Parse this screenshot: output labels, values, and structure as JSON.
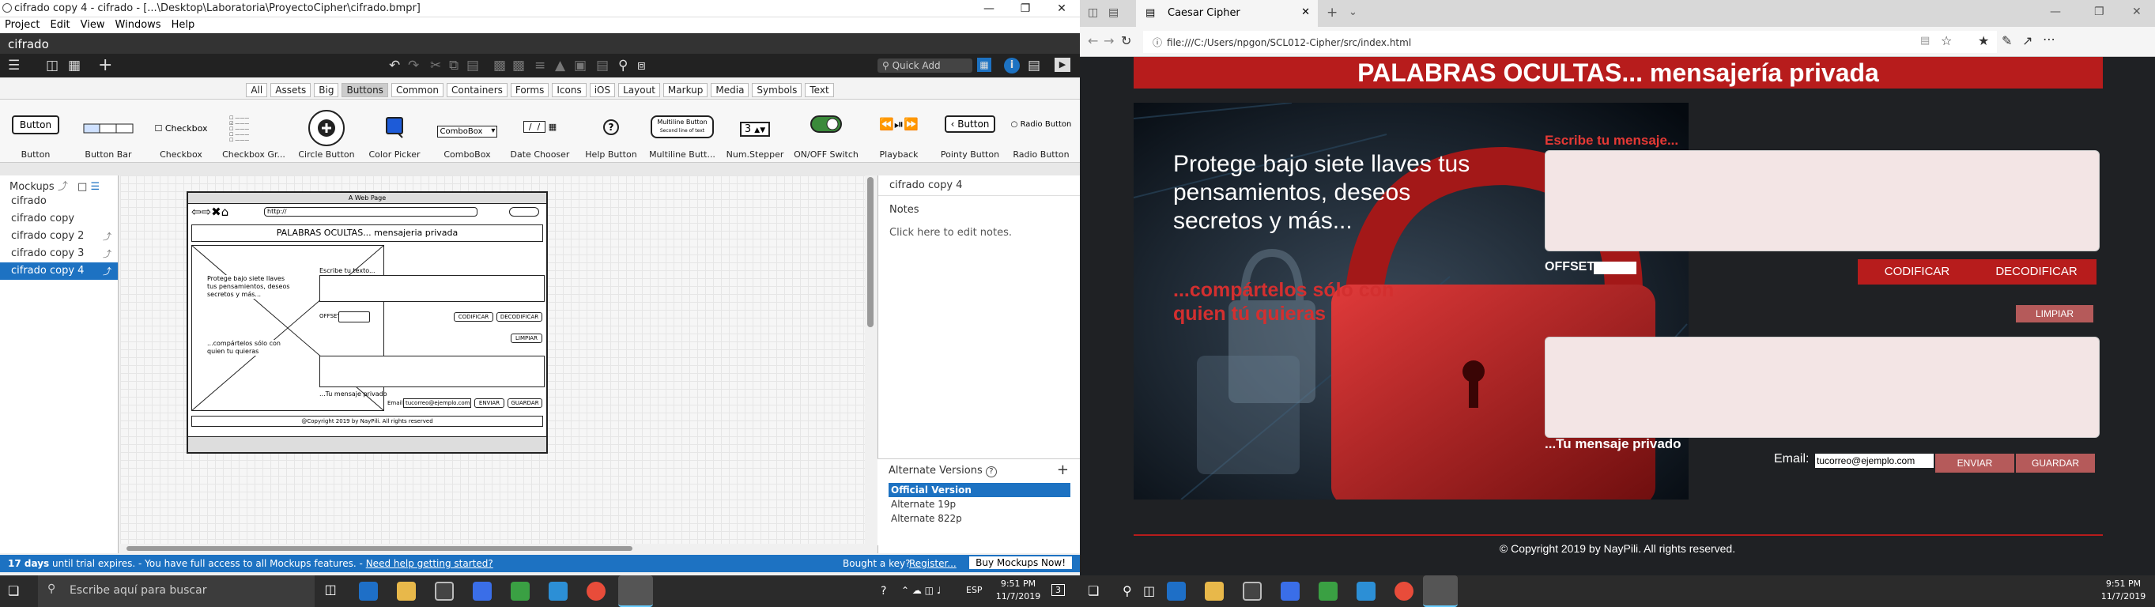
{
  "left": {
    "title": "cifrado copy 4 - cifrado - [...\\Desktop\\Laboratoria\\ProyectoCipher\\cifrado.bmpr]",
    "menu": [
      "Project",
      "Edit",
      "View",
      "Windows",
      "Help"
    ],
    "doc_name": "cifrado",
    "quick_add": "Quick Add",
    "categories": [
      "All",
      "Assets",
      "Big",
      "Buttons",
      "Common",
      "Containers",
      "Forms",
      "Icons",
      "iOS",
      "Layout",
      "Markup",
      "Media",
      "Symbols",
      "Text"
    ],
    "selected_category": "Buttons",
    "library": [
      "Button",
      "Button Bar",
      "Checkbox",
      "Checkbox Gr...",
      "Circle Button",
      "Color Picker",
      "ComboBox",
      "Date Chooser",
      "Help Button",
      "Multiline Butt...",
      "Num.Stepper",
      "ON/OFF Switch",
      "Playback",
      "Pointy Button",
      "Radio Button"
    ],
    "lib_previews": {
      "button": "Button",
      "checkbox": "Checkbox",
      "combobox": "ComboBox",
      "multiline": "Multiline Button",
      "multiline_sub": "Second line of text",
      "stepper": "3",
      "pointy": "Button",
      "radio": "Radio Button"
    },
    "sidebar_title": "Mockups",
    "mockups": [
      "cifrado",
      "cifrado copy",
      "cifrado copy 2",
      "cifrado copy 3",
      "cifrado copy 4"
    ],
    "selected_mockup": "cifrado copy 4",
    "mock": {
      "window_title": "A Web Page",
      "url": "http://",
      "heading": "PALABRAS OCULTAS... mensajeria privada",
      "hero_text": "Protege bajo siete llaves tus pensamientos, deseos secretos y más...",
      "hero_sub": "...compártelos sólo con quien tu quieras",
      "write_label": "Escribe tu texto...",
      "offset": "OFFSET",
      "encode": "CODIFICAR",
      "decode": "DECODIFICAR",
      "clear": "LIMPIAR",
      "private_msg": "...Tu mensaje privado",
      "email_label": "Email",
      "email_value": "tucorreo@ejemplo.com",
      "send": "ENVIAR",
      "save": "GUARDAR",
      "footer": "@Copyright 2019 by NayPili. All rights reserved"
    },
    "props_title": "cifrado copy 4",
    "notes_label": "Notes",
    "notes_hint": "Click here to edit notes.",
    "alt_title": "Alternate Versions",
    "alt_help": "?",
    "alt_add": "+",
    "alternates": [
      "Official Version",
      "Alternate 19p",
      "Alternate 822p"
    ],
    "status": {
      "days": "17 days",
      "message": " until trial expires. - You have full access to all Mockups features. - ",
      "help_link": "Need help getting started?",
      "bought": "Bought a key?",
      "register": "Register...",
      "buy": "Buy Mockups Now!"
    },
    "taskbar": {
      "search": "Escribe aquí para buscar",
      "lang": "ESP",
      "time": "9:51 PM",
      "date": "11/7/2019",
      "notif": "3"
    }
  },
  "right": {
    "tab_title": "Caesar Cipher",
    "url": "file:///C:/Users/npgon/SCL012-Cipher/src/index.html",
    "page": {
      "heading": "PALABRAS OCULTAS... mensajería privada",
      "hero_text": "Protege bajo siete llaves tus pensamientos, deseos secretos y más...",
      "hero_sub": "...compártelos sólo con quien tú quieras",
      "write_label": "Escribe tu mensaje...",
      "offset_label": "OFFSET",
      "offset_value": "",
      "encode": "CODIFICAR",
      "decode": "DECODIFICAR",
      "clear": "LIMPIAR",
      "private_msg": "...Tu mensaje privado",
      "email_label": "Email:",
      "email_value": "tucorreo@ejemplo.com",
      "send": "ENVIAR",
      "save": "GUARDAR",
      "footer": "© Copyright 2019 by NayPili. All rights reserved."
    },
    "taskbar": {
      "time": "9:51 PM",
      "date": "11/7/2019"
    }
  },
  "colors": {
    "brand_red": "#b71c1c",
    "selection_blue": "#1d72c2",
    "dark_bg": "#1f2124"
  }
}
